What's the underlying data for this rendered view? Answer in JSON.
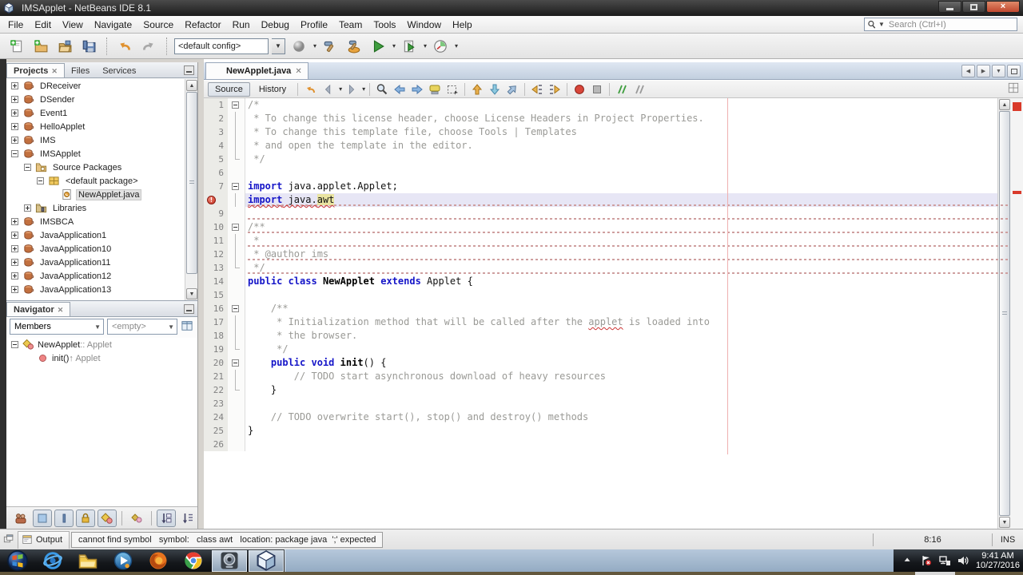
{
  "window": {
    "title": "IMSApplet - NetBeans IDE 8.1"
  },
  "menu": {
    "items": [
      "File",
      "Edit",
      "View",
      "Navigate",
      "Source",
      "Refactor",
      "Run",
      "Debug",
      "Profile",
      "Team",
      "Tools",
      "Window",
      "Help"
    ]
  },
  "search": {
    "placeholder": "Search (Ctrl+I)"
  },
  "toolbar": {
    "config_value": "<default config>",
    "icons": [
      "new-file",
      "new-project",
      "open-project",
      "save-all",
      "sep",
      "undo",
      "redo",
      "sep",
      "config",
      "deploy",
      "build",
      "clean-build",
      "run",
      "debug",
      "profile"
    ]
  },
  "projects_panel": {
    "tabs": [
      {
        "label": "Projects",
        "active": true,
        "closable": true
      },
      {
        "label": "Files"
      },
      {
        "label": "Services"
      }
    ],
    "tree": [
      {
        "label": "DReceiver",
        "icon": "project-icon",
        "level": 0,
        "exp": "plus"
      },
      {
        "label": "DSender",
        "icon": "project-icon",
        "level": 0,
        "exp": "plus"
      },
      {
        "label": "Event1",
        "icon": "project-icon",
        "level": 0,
        "exp": "plus"
      },
      {
        "label": "HelloApplet",
        "icon": "project-icon",
        "level": 0,
        "exp": "plus"
      },
      {
        "label": "IMS",
        "icon": "project-icon",
        "level": 0,
        "exp": "plus"
      },
      {
        "label": "IMSApplet",
        "icon": "project-icon",
        "level": 0,
        "exp": "minus"
      },
      {
        "label": "Source Packages",
        "icon": "source-folder-icon",
        "level": 1,
        "exp": "minus"
      },
      {
        "label": "<default package>",
        "icon": "package-icon",
        "level": 2,
        "exp": "minus"
      },
      {
        "label": "NewApplet.java",
        "icon": "java-file-icon",
        "level": 3,
        "exp": "none",
        "selected": true
      },
      {
        "label": "Libraries",
        "icon": "libraries-icon",
        "level": 1,
        "exp": "plus"
      },
      {
        "label": "IMSBCA",
        "icon": "project-icon",
        "level": 0,
        "exp": "plus"
      },
      {
        "label": "JavaApplication1",
        "icon": "project-icon",
        "level": 0,
        "exp": "plus"
      },
      {
        "label": "JavaApplication10",
        "icon": "project-icon",
        "level": 0,
        "exp": "plus"
      },
      {
        "label": "JavaApplication11",
        "icon": "project-icon",
        "level": 0,
        "exp": "plus"
      },
      {
        "label": "JavaApplication12",
        "icon": "project-icon",
        "level": 0,
        "exp": "plus"
      },
      {
        "label": "JavaApplication13",
        "icon": "project-icon",
        "level": 0,
        "exp": "plus"
      }
    ]
  },
  "navigator_panel": {
    "tab": "Navigator",
    "members_filter": "Members",
    "scope_filter": "<empty>",
    "items": [
      {
        "primary": "NewApplet ",
        "secondary": ":: Applet",
        "icon": "class-icon",
        "exp": "minus",
        "level": 0
      },
      {
        "primary": "init() ",
        "secondary": "↑ Applet",
        "icon": "method-icon",
        "exp": "none",
        "level": 1
      }
    ],
    "filters": [
      "inherited-members",
      "show-fields",
      "show-static",
      "show-non-public",
      "show-inner-classes",
      "sep2",
      "show-anonymous",
      "sep",
      "sort-alpha",
      "sort-source"
    ]
  },
  "editor": {
    "tab_label": "NewApplet.java",
    "source_label": "Source",
    "history_label": "History",
    "toolbar_icons": [
      "last-edit",
      "back",
      "forward",
      "sep",
      "find",
      "find-prev",
      "find-next",
      "highlight",
      "rect-select",
      "sep",
      "prev-occurrence",
      "next-occurrence",
      "bookmark",
      "sep",
      "indent-left",
      "indent-right",
      "sep",
      "macro-record",
      "macro-stop",
      "sep",
      "comment",
      "uncomment"
    ],
    "code_lines": [
      {
        "n": 1,
        "f": "o",
        "tokens": [
          [
            "cm",
            "/*"
          ]
        ]
      },
      {
        "n": 2,
        "f": "l",
        "tokens": [
          [
            "cm",
            " * To change this license header, choose License Headers in Project Properties."
          ]
        ]
      },
      {
        "n": 3,
        "f": "l",
        "tokens": [
          [
            "cm",
            " * To change this template file, choose Tools | Templates"
          ]
        ]
      },
      {
        "n": 4,
        "f": "l",
        "tokens": [
          [
            "cm",
            " * and open the template in the editor."
          ]
        ]
      },
      {
        "n": 5,
        "f": "e",
        "tokens": [
          [
            "cm",
            " */"
          ]
        ]
      },
      {
        "n": 6,
        "f": "",
        "tokens": []
      },
      {
        "n": 7,
        "f": "o",
        "tokens": [
          [
            "kw",
            "import"
          ],
          [
            "pl",
            " java.applet.Applet;"
          ]
        ]
      },
      {
        "n": 8,
        "f": "l",
        "err": true,
        "cur": true,
        "sq": true,
        "tokens": [
          [
            "kw w",
            "import"
          ],
          [
            "pl w",
            " java."
          ],
          [
            "pl w hl",
            "awt"
          ]
        ]
      },
      {
        "n": 9,
        "f": "",
        "sq": true,
        "tokens": []
      },
      {
        "n": 10,
        "f": "o",
        "sq": true,
        "tokens": [
          [
            "cm",
            "/**"
          ]
        ]
      },
      {
        "n": 11,
        "f": "l",
        "sq": true,
        "tokens": [
          [
            "cm",
            " *"
          ]
        ]
      },
      {
        "n": 12,
        "f": "l",
        "sq": true,
        "tokens": [
          [
            "cm",
            " * @author ims"
          ]
        ]
      },
      {
        "n": 13,
        "f": "e",
        "sq": true,
        "tokens": [
          [
            "cm",
            " */"
          ]
        ]
      },
      {
        "n": 14,
        "f": "",
        "tokens": [
          [
            "kw",
            "public"
          ],
          [
            "pl",
            " "
          ],
          [
            "kw",
            "class"
          ],
          [
            "pl",
            " "
          ],
          [
            "cls",
            "NewApplet"
          ],
          [
            "pl",
            " "
          ],
          [
            "kw",
            "extends"
          ],
          [
            "pl",
            " Applet {"
          ]
        ]
      },
      {
        "n": 15,
        "f": "",
        "tokens": []
      },
      {
        "n": 16,
        "f": "o",
        "tokens": [
          [
            "cm",
            "    /**"
          ]
        ]
      },
      {
        "n": 17,
        "f": "l",
        "tokens": [
          [
            "cm",
            "     * Initialization method that will be called after the "
          ],
          [
            "cm w",
            "applet"
          ],
          [
            "cm",
            " is loaded into"
          ]
        ]
      },
      {
        "n": 18,
        "f": "l",
        "tokens": [
          [
            "cm",
            "     * the browser."
          ]
        ]
      },
      {
        "n": 19,
        "f": "e",
        "tokens": [
          [
            "cm",
            "     */"
          ]
        ]
      },
      {
        "n": 20,
        "f": "o",
        "tokens": [
          [
            "pl",
            "    "
          ],
          [
            "kw",
            "public"
          ],
          [
            "pl",
            " "
          ],
          [
            "kw",
            "void"
          ],
          [
            "pl",
            " "
          ],
          [
            "mth",
            "init"
          ],
          [
            "pl",
            "() {"
          ]
        ]
      },
      {
        "n": 21,
        "f": "l",
        "tokens": [
          [
            "cm",
            "        // TODO start asynchronous download of heavy resources"
          ]
        ]
      },
      {
        "n": 22,
        "f": "e",
        "tokens": [
          [
            "pl",
            "    }"
          ]
        ]
      },
      {
        "n": 23,
        "f": "",
        "tokens": []
      },
      {
        "n": 24,
        "f": "",
        "tokens": [
          [
            "cm",
            "    // TODO overwrite start(), stop() and destroy() methods"
          ]
        ]
      },
      {
        "n": 25,
        "f": "",
        "tokens": [
          [
            "pl",
            "}"
          ]
        ]
      },
      {
        "n": 26,
        "f": "",
        "tokens": []
      }
    ]
  },
  "statusbar": {
    "output_label": "Output",
    "message": "cannot find symbol   symbol:   class awt   location: package java  ';' expected",
    "position": "8:16",
    "mode": "INS"
  },
  "taskbar": {
    "apps": [
      {
        "name": "start-button"
      },
      {
        "name": "internet-explorer"
      },
      {
        "name": "windows-explorer"
      },
      {
        "name": "media-player"
      },
      {
        "name": "firefox"
      },
      {
        "name": "chrome"
      },
      {
        "name": "camera-app",
        "active": true
      },
      {
        "name": "netbeans",
        "active": true
      }
    ],
    "tray_icons": [
      "tray-expand",
      "action-center",
      "network",
      "volume"
    ],
    "clock": {
      "time": "9:41 AM",
      "date": "10/27/2016"
    }
  },
  "colors": {
    "keyword": "#1515c8",
    "comment": "#9a9a96",
    "error": "#cc3333",
    "occurrence_highlight": "#e9e4a1",
    "current_line": "#e7e6f5",
    "margin_line": "#efb0b0"
  }
}
